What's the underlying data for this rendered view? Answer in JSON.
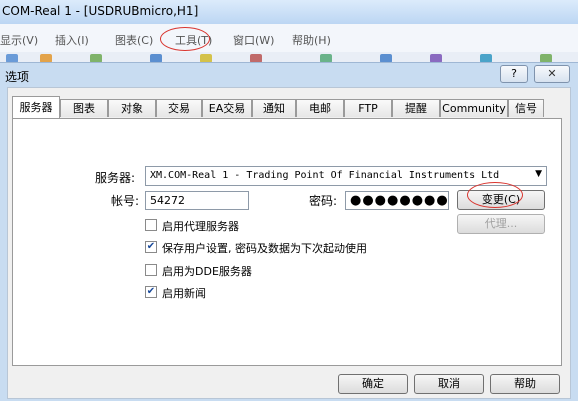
{
  "window": {
    "title": "COM-Real 1 - [USDRUBmicro,H1]"
  },
  "menu": {
    "items": [
      "显示(V)",
      "插入(I)",
      "图表(C)",
      "工具(T)",
      "窗口(W)",
      "帮助(H)"
    ]
  },
  "dialog": {
    "title": "选项",
    "help_label": "?",
    "close_label": "✕",
    "tabs": [
      "服务器",
      "图表",
      "对象",
      "交易",
      "EA交易",
      "通知",
      "电邮",
      "FTP",
      "提醒",
      "Community",
      "信号"
    ],
    "active_tab": "服务器",
    "server_label": "服务器:",
    "server_value": "XM.COM-Real 1 - Trading Point Of Financial Instruments Ltd",
    "account_label": "帐号:",
    "account_value": "54272",
    "password_label": "密码:",
    "password_value": "●●●●●●●●●",
    "change_button": "变更(C)",
    "proxy_button": "代理...",
    "options": [
      {
        "label": "启用代理服务器",
        "checked": false
      },
      {
        "label": "保存用户设置, 密码及数据为下次起动使用",
        "checked": true
      },
      {
        "label": "启用为DDE服务器",
        "checked": false
      },
      {
        "label": "启用新闻",
        "checked": true
      }
    ],
    "ok_button": "确定",
    "cancel_button": "取消",
    "help_button": "帮助"
  }
}
